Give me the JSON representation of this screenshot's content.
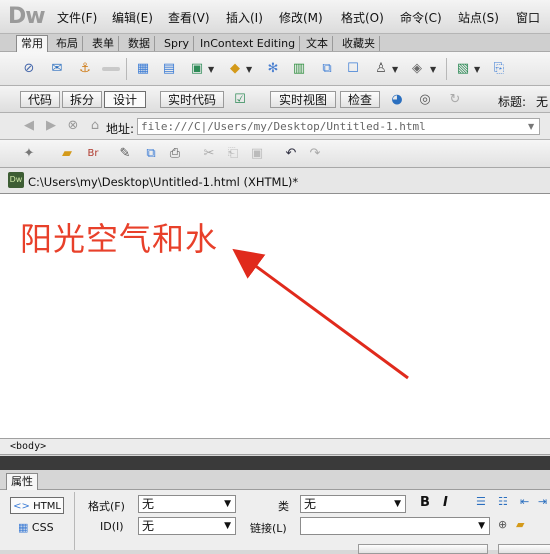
{
  "app": {
    "logo": "Dw"
  },
  "menu": [
    {
      "label": "文件(F)"
    },
    {
      "label": "编辑(E)"
    },
    {
      "label": "查看(V)"
    },
    {
      "label": "插入(I)"
    },
    {
      "label": "修改(M)"
    },
    {
      "label": "格式(O)"
    },
    {
      "label": "命令(C)"
    },
    {
      "label": "站点(S)"
    },
    {
      "label": "窗口"
    }
  ],
  "insert_tabs": [
    {
      "label": "常用"
    },
    {
      "label": "布局"
    },
    {
      "label": "表单"
    },
    {
      "label": "数据"
    },
    {
      "label": "Spry"
    },
    {
      "label": "InContext Editing"
    },
    {
      "label": "文本"
    },
    {
      "label": "收藏夹"
    }
  ],
  "doc_toolbar": {
    "code": "代码",
    "split": "拆分",
    "design": "设计",
    "live_code": "实时代码",
    "live_view": "实时视图",
    "inspect": "检查",
    "title_label": "标题:",
    "title_value": "无"
  },
  "address": {
    "label": "地址:",
    "value": "file:///C|/Users/my/Desktop/Untitled-1.html"
  },
  "document": {
    "tab_title": "C:\\Users\\my\\Desktop\\Untitled-1.html (XHTML)*",
    "heading_text": "阳光空气和水"
  },
  "tag_selector": {
    "tag": "<body>"
  },
  "properties": {
    "title": "属性",
    "html_button": "HTML",
    "css_button": "CSS",
    "format_label": "格式(F)",
    "format_value": "无",
    "class_label": "类",
    "class_value": "无",
    "id_label": "ID(I)",
    "id_value": "无",
    "link_label": "链接(L)",
    "link_value": "",
    "bold": "B",
    "italic": "I"
  },
  "colors": {
    "heading": "#e8402a",
    "arrow": "#e02a1c"
  },
  "icons": [
    "dw-logo",
    "hyperlink-icon",
    "email-link-icon",
    "named-anchor-icon",
    "hr-icon",
    "table-icon",
    "insert-div-icon",
    "images-icon",
    "media-icon",
    "widget-icon",
    "date-icon",
    "server-side-include-icon",
    "comment-icon",
    "head-icon",
    "script-icon",
    "templates-icon",
    "tag-chooser-icon"
  ]
}
